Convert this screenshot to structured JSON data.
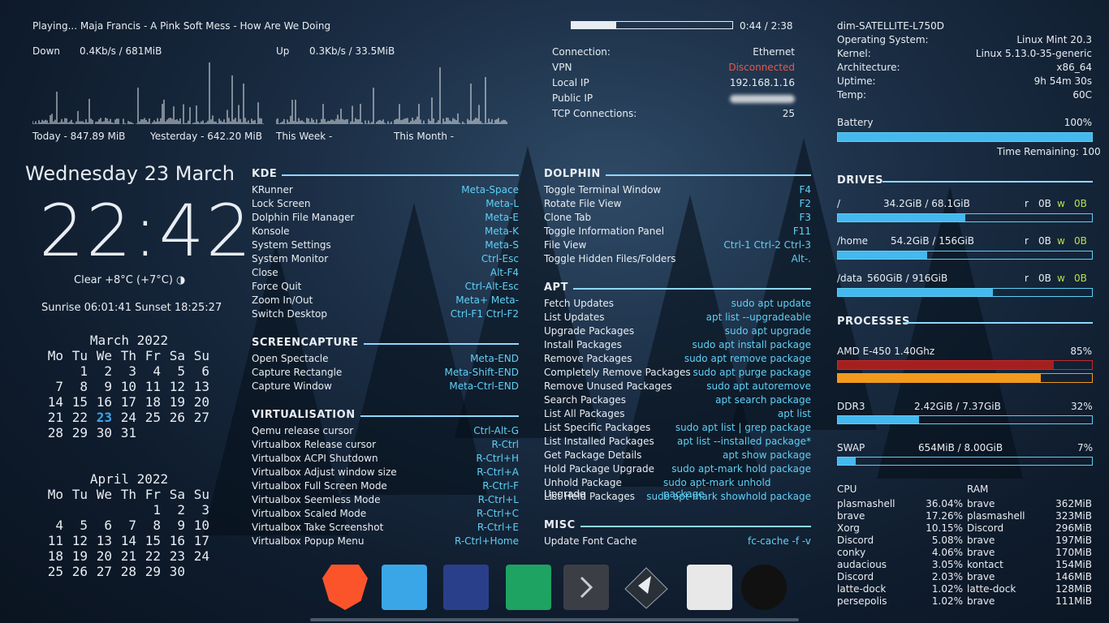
{
  "player": {
    "track": "Playing... Maja Francis - A Pink Soft Mess - How Are We Doing",
    "time": "0:44 / 2:38",
    "progress": 0.28
  },
  "net": {
    "down_label": "Down",
    "down_value": "0.4Kb/s  /  681MiB",
    "up_label": "Up",
    "up_value": "0.3Kb/s / 33.5MiB",
    "today": "Today - 847.89 MiB",
    "yesterday": "Yesterday - 642.20 MiB",
    "this_week": "This Week -",
    "this_month": "This Month -",
    "connection": [
      "Connection:",
      "Ethernet"
    ],
    "vpn": [
      "VPN",
      "Disconnected"
    ],
    "local_ip": [
      "Local IP",
      "192.168.1.16"
    ],
    "public_ip": [
      "Public IP",
      ""
    ],
    "tcp": [
      "TCP Connections:",
      "25"
    ]
  },
  "clock": {
    "date": "Wednesday 23 March",
    "time": "22:42",
    "weather": "Clear +8°C (+7°C) ◑",
    "sun": "Sunrise 06:01:41 Sunset 18:25:27"
  },
  "calendars": [
    {
      "title": "March 2022",
      "headers": [
        "Mo",
        "Tu",
        "We",
        "Th",
        "Fr",
        "Sa",
        "Su"
      ],
      "days": [
        "",
        "1",
        "2",
        "3",
        "4",
        "5",
        "6",
        "7",
        "8",
        "9",
        "10",
        "11",
        "12",
        "13",
        "14",
        "15",
        "16",
        "17",
        "18",
        "19",
        "20",
        "21",
        "22",
        "23",
        "24",
        "25",
        "26",
        "27",
        "28",
        "29",
        "30",
        "31"
      ],
      "today": "23"
    },
    {
      "title": "April 2022",
      "headers": [
        "Mo",
        "Tu",
        "We",
        "Th",
        "Fr",
        "Sa",
        "Su"
      ],
      "days": [
        "",
        "",
        "",
        "",
        "1",
        "2",
        "3",
        "4",
        "5",
        "6",
        "7",
        "8",
        "9",
        "10",
        "11",
        "12",
        "13",
        "14",
        "15",
        "16",
        "17",
        "18",
        "19",
        "20",
        "21",
        "22",
        "23",
        "24",
        "25",
        "26",
        "27",
        "28",
        "29",
        "30"
      ],
      "today": ""
    }
  ],
  "shortcuts_left": [
    {
      "title": "KDE",
      "items": [
        [
          "KRunner",
          "Meta-Space"
        ],
        [
          "Lock Screen",
          "Meta-L"
        ],
        [
          "Dolphin File Manager",
          "Meta-E"
        ],
        [
          "Konsole",
          "Meta-K"
        ],
        [
          "System Settings",
          "Meta-S"
        ],
        [
          "System Monitor",
          "Ctrl-Esc"
        ],
        [
          "Close",
          "Alt-F4"
        ],
        [
          "Force Quit",
          "Ctrl-Alt-Esc"
        ],
        [
          "Zoom In/Out",
          "Meta+ Meta-"
        ],
        [
          "Switch Desktop",
          "Ctrl-F1 Ctrl-F2"
        ]
      ]
    },
    {
      "title": "SCREENCAPTURE",
      "items": [
        [
          "Open Spectacle",
          "Meta-END"
        ],
        [
          "Capture Rectangle",
          "Meta-Shift-END"
        ],
        [
          "Capture Window",
          "Meta-Ctrl-END"
        ]
      ]
    },
    {
      "title": "VIRTUALISATION",
      "items": [
        [
          "Qemu release cursor",
          "Ctrl-Alt-G"
        ],
        [
          "Virtualbox Release cursor",
          "R-Ctrl"
        ],
        [
          "Virtualbox ACPI Shutdown",
          "R-Ctrl+H"
        ],
        [
          "Virtualbox Adjust window size",
          "R-Ctrl+A"
        ],
        [
          "Virtualbox Full Screen Mode",
          "R-Ctrl-F"
        ],
        [
          "Virtualbox Seemless Mode",
          "R-Ctrl+L"
        ],
        [
          "Virtualbox Scaled Mode",
          "R-Ctrl+C"
        ],
        [
          "Virtualbox Take Screenshot",
          "R-Ctrl+E"
        ],
        [
          "Virtualbox Popup Menu",
          "R-Ctrl+Home"
        ]
      ]
    }
  ],
  "shortcuts_right": [
    {
      "title": "DOLPHIN",
      "items": [
        [
          "Toggle Terminal Window",
          "F4"
        ],
        [
          "Rotate File View",
          "F2"
        ],
        [
          "Clone Tab",
          "F3"
        ],
        [
          "Toggle Information Panel",
          "F11"
        ],
        [
          "File View",
          "Ctrl-1 Ctrl-2 Ctrl-3"
        ],
        [
          "Toggle Hidden Files/Folders",
          "Alt-."
        ]
      ]
    },
    {
      "title": "APT",
      "items": [
        [
          "Fetch Updates",
          "sudo apt update"
        ],
        [
          "List Updates",
          "apt list --upgradeable"
        ],
        [
          "Upgrade Packages",
          "sudo apt upgrade"
        ],
        [
          "Install Packages",
          "sudo apt install package"
        ],
        [
          "Remove Packages",
          "sudo apt remove package"
        ],
        [
          "Completely Remove Packages",
          "sudo apt purge package"
        ],
        [
          "Remove Unused Packages",
          "sudo apt autoremove"
        ],
        [
          "Search Packages",
          "apt search package"
        ],
        [
          "List All Packages",
          "apt list"
        ],
        [
          "List Specific Packages",
          "sudo apt list | grep package"
        ],
        [
          "List Installed Packages",
          "apt list --installed package*"
        ],
        [
          "Get Package Details",
          "apt show package"
        ],
        [
          "Hold Package Upgrade",
          "sudo apt-mark hold package"
        ],
        [
          "Unhold Package Upgrade",
          "sudo apt-mark unhold package"
        ],
        [
          "List Held Packages",
          "sudo apt-mark showhold package"
        ]
      ]
    },
    {
      "title": "MISC",
      "items": [
        [
          "Update Font Cache",
          "fc-cache -f -v"
        ]
      ]
    }
  ],
  "system": {
    "hostname": "dim-SATELLITE-L750D",
    "rows": [
      [
        "Operating System:",
        "Linux Mint 20.3"
      ],
      [
        "Kernel:",
        "Linux 5.13.0-35-generic"
      ],
      [
        "Architecture:",
        "x86_64"
      ],
      [
        "Uptime:",
        "9h 54m 30s"
      ],
      [
        "Temp:",
        "60C"
      ]
    ],
    "battery_label": "Battery",
    "battery_pct": "100%",
    "battery_level": 1.0,
    "time_remaining": "Time Remaining: 100"
  },
  "drives": {
    "title": "DRIVES",
    "items": [
      {
        "mount": "/",
        "usage": "34.2GiB / 68.1GiB",
        "r": "r",
        "r_val": "0B",
        "w": "w",
        "w_val": "0B",
        "fill": 0.5
      },
      {
        "mount": "/home",
        "usage": "54.2GiB / 156GiB",
        "r": "r",
        "r_val": "0B",
        "w": "w",
        "w_val": "0B",
        "fill": 0.35
      },
      {
        "mount": "/data",
        "usage": "560GiB / 916GiB",
        "r": "r",
        "r_val": "0B",
        "w": "w",
        "w_val": "0B",
        "fill": 0.61
      }
    ]
  },
  "processes": {
    "title": "PROCESSES",
    "cpu_name": "AMD E-450 1.40Ghz",
    "cpu_pct": "85%",
    "cpu_level": 0.85,
    "cpu2_level": 0.8,
    "ram_name": "DDR3",
    "ram_usage": "2.42GiB / 7.37GiB",
    "ram_pct": "32%",
    "ram_level": 0.32,
    "swap_name": "SWAP",
    "swap_usage": "654MiB / 8.00GiB",
    "swap_pct": "7%",
    "swap_level": 0.07,
    "cpu_header": "CPU",
    "ram_header": "RAM",
    "top": [
      [
        "plasmashell",
        "36.04%",
        "brave",
        "362MiB"
      ],
      [
        "brave",
        "17.26%",
        "plasmashell",
        "323MiB"
      ],
      [
        "Xorg",
        "10.15%",
        "Discord",
        "296MiB"
      ],
      [
        "Discord",
        "5.08%",
        "brave",
        "197MiB"
      ],
      [
        "conky",
        "4.06%",
        "brave",
        "170MiB"
      ],
      [
        "audacious",
        "3.05%",
        "kontact",
        "154MiB"
      ],
      [
        "Discord",
        "2.03%",
        "brave",
        "146MiB"
      ],
      [
        "latte-dock",
        "1.02%",
        "latte-dock",
        "128MiB"
      ],
      [
        "persepolis",
        "1.02%",
        "brave",
        "111MiB"
      ]
    ]
  },
  "dock": [
    {
      "name": "brave-icon",
      "color": "#fb542b"
    },
    {
      "name": "files-icon",
      "color": "#3aa6e8"
    },
    {
      "name": "cloud-icon",
      "color": "#2a3f8a"
    },
    {
      "name": "spreadsheet-icon",
      "color": "#1ea362"
    },
    {
      "name": "terminal-icon",
      "color": "#3b3f45"
    },
    {
      "name": "inkscape-icon",
      "color": "#1e2328"
    },
    {
      "name": "text-editor-icon",
      "color": "#e8e8e8"
    },
    {
      "name": "audacious-icon",
      "color": "#111111"
    }
  ]
}
